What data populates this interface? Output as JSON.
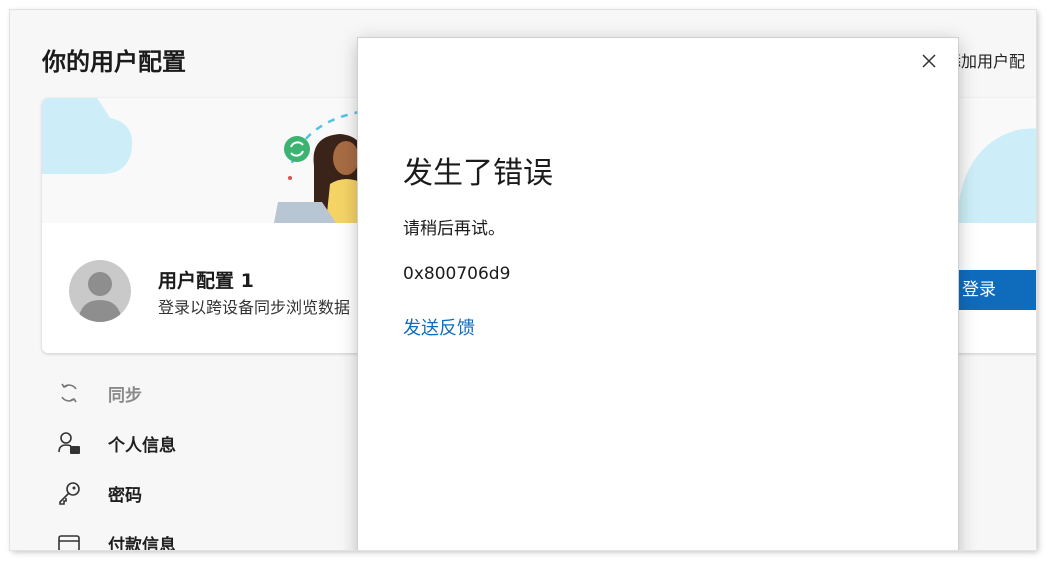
{
  "page": {
    "title": "你的用户配置",
    "add_profile_label": "添加用户配"
  },
  "profile_card": {
    "name": "用户配置 1",
    "description": "登录以跨设备同步浏览数据",
    "signin_label": "登录"
  },
  "nav": {
    "items": [
      {
        "label": "同步",
        "icon": "sync-icon",
        "enabled": false
      },
      {
        "label": "个人信息",
        "icon": "personal-info-icon",
        "enabled": true
      },
      {
        "label": "密码",
        "icon": "key-icon",
        "enabled": true
      },
      {
        "label": "付款信息",
        "icon": "payment-card-icon",
        "enabled": true
      }
    ]
  },
  "error_dialog": {
    "title": "发生了错误",
    "message": "请稍后再试。",
    "error_code": "0x800706d9",
    "feedback_link": "发送反馈",
    "close_icon": "close-icon"
  },
  "colors": {
    "accent": "#0f6cbd",
    "cloud": "#cdeef8",
    "sync_badge": "#3cb371",
    "illustration_shirt": "#f6d365",
    "disabled_text": "#8a8a8a"
  }
}
